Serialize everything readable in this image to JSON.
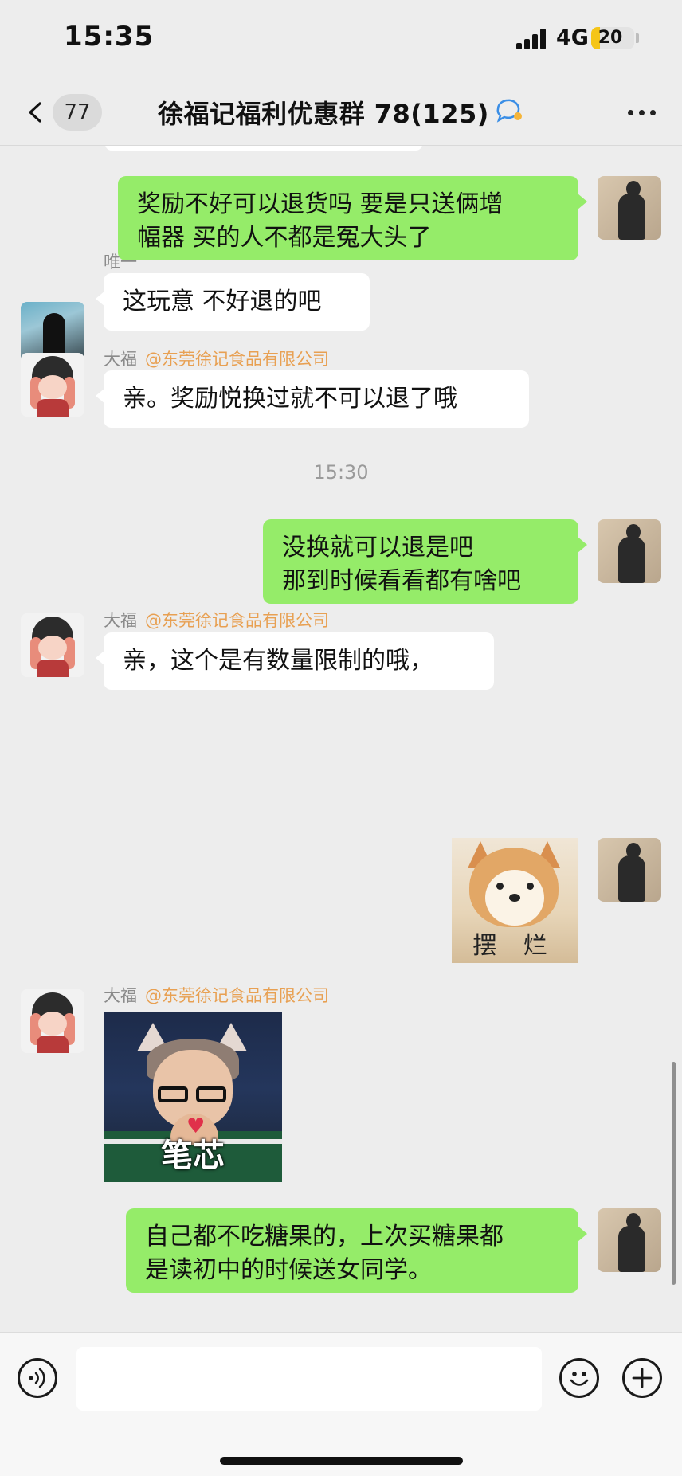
{
  "status_bar": {
    "time": "15:35",
    "network": "4G",
    "battery_level": "20",
    "battery_fraction": 0.2
  },
  "nav": {
    "back_icon": "chevron-left-icon",
    "unread_count": "77",
    "title": "徐福记福利优惠群 78(125)",
    "title_badge_icon": "chat-bubble-icon",
    "more_icon": "more-horizontal-icon"
  },
  "messages": [
    {
      "direction": "outgoing",
      "type": "text",
      "text": "奖励不好可以退货吗 要是只送俩增\n幅器 买的人不都是冤大头了"
    },
    {
      "direction": "incoming",
      "type": "text",
      "sender": "唯一",
      "text": "这玩意 不好退的吧"
    },
    {
      "direction": "incoming",
      "type": "text",
      "sender": "大福",
      "sender_tag": "@东莞徐记食品有限公司",
      "text": "亲。奖励悦换过就不可以退了哦"
    },
    {
      "type": "timestamp",
      "text": "15:30"
    },
    {
      "direction": "outgoing",
      "type": "text",
      "text": "没换就可以退是吧\n那到时候看看都有啥吧"
    },
    {
      "direction": "incoming",
      "type": "text",
      "sender": "大福",
      "sender_tag": "@东莞徐记食品有限公司",
      "text": "亲，这个是有数量限制的哦，"
    },
    {
      "direction": "outgoing",
      "type": "sticker",
      "caption": "摆 烂",
      "sticker_icon": "doge-sticker"
    },
    {
      "direction": "incoming",
      "type": "sticker",
      "sender": "大福",
      "sender_tag": "@东莞徐记食品有限公司",
      "caption": "笔芯",
      "sticker_icon": "heart-hands-sticker"
    },
    {
      "direction": "outgoing",
      "type": "text",
      "text": "自己都不吃糖果的，上次买糖果都\n是读初中的时候送女同学。"
    }
  ],
  "input_bar": {
    "voice_icon": "voice-input-icon",
    "emoji_icon": "emoji-icon",
    "plus_icon": "plus-circle-icon",
    "text_value": ""
  },
  "colors": {
    "outgoing_bubble": "#95ec69",
    "incoming_bubble": "#ffffff",
    "background": "#ededed",
    "sender_tag": "#e8a052"
  }
}
